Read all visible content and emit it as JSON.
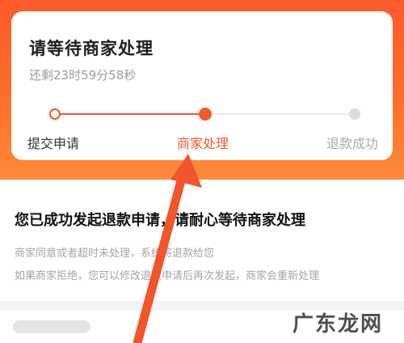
{
  "status": {
    "title": "请等待商家处理",
    "countdown": "还剩23时59分58秒"
  },
  "progress": {
    "steps": [
      {
        "label": "提交申请",
        "state": "done"
      },
      {
        "label": "商家处理",
        "state": "current"
      },
      {
        "label": "退款成功",
        "state": "pending"
      }
    ],
    "active_color": "#ef5b2b",
    "inactive_color": "#dcdcdc"
  },
  "info": {
    "heading": "您已成功发起退款申请，请耐心等待商家处理",
    "line1": "商家同意或者超时未处理，系统将退款给您",
    "line2": "如果商家拒绝，您可以修改退款申请后再次发起，商家会重新处理"
  },
  "overlay": {
    "arrow_icon": "pointer-arrow-icon",
    "arrow_color": "#f2552c"
  },
  "watermark": {
    "text": "广东龙网"
  },
  "colors": {
    "header_gradient_top": "#fb5a2c",
    "header_gradient_bottom": "#ff8b3c",
    "accent": "#ef5b2b"
  }
}
